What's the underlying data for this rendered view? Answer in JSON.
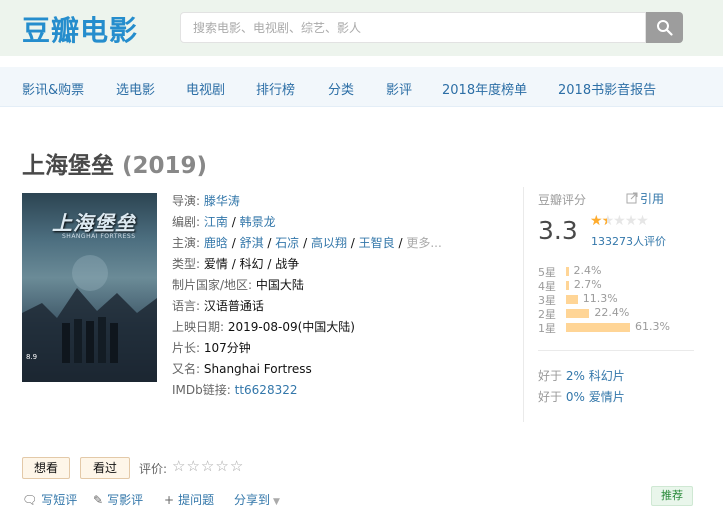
{
  "header": {
    "logo": "豆瓣电影",
    "search_placeholder": "搜索电影、电视剧、综艺、影人",
    "search_icon": "search-icon"
  },
  "nav": {
    "items": [
      "影讯&购票",
      "选电影",
      "电视剧",
      "排行榜",
      "分类",
      "影评",
      "2018年度榜单",
      "2018书影音报告"
    ]
  },
  "movie": {
    "title": "上海堡垒",
    "year": "(2019)",
    "poster": {
      "title": "上海堡垒",
      "subtitle": "SHANGHAI FORTRESS",
      "date": "8.9"
    },
    "director_label": "导演:",
    "director": "滕华涛",
    "writer_label": "编剧:",
    "writers": [
      "江南",
      "韩景龙"
    ],
    "cast_label": "主演:",
    "cast": [
      "鹿晗",
      "舒淇",
      "石凉",
      "高以翔",
      "王智良"
    ],
    "cast_more": "更多...",
    "genre_label": "类型:",
    "genres": "爱情 / 科幻 / 战争",
    "country_label": "制片国家/地区:",
    "country": "中国大陆",
    "language_label": "语言:",
    "language": "汉语普通话",
    "release_label": "上映日期:",
    "release": "2019-08-09(中国大陆)",
    "runtime_label": "片长:",
    "runtime": "107分钟",
    "aka_label": "又名:",
    "aka": "Shanghai Fortress",
    "imdb_label": "IMDb链接:",
    "imdb": "tt6628322"
  },
  "rating": {
    "title": "豆瓣评分",
    "cite": "引用",
    "score": "3.3",
    "stars_filled": 1.5,
    "votes": "133273人评价",
    "distribution": [
      {
        "label": "5星",
        "pct": "2.4%",
        "value": 2.4
      },
      {
        "label": "4星",
        "pct": "2.7%",
        "value": 2.7
      },
      {
        "label": "3星",
        "pct": "11.3%",
        "value": 11.3
      },
      {
        "label": "2星",
        "pct": "22.4%",
        "value": 22.4
      },
      {
        "label": "1星",
        "pct": "61.3%",
        "value": 61.3
      }
    ],
    "better_than": [
      {
        "prefix": "好于",
        "value": "2% 科幻片"
      },
      {
        "prefix": "好于",
        "value": "0% 爱情片"
      }
    ],
    "star_color": "#ffac2d",
    "bar_color": "#ffd596"
  },
  "actions": {
    "want": "想看",
    "seen": "看过",
    "my_rating_label": "评价:",
    "short_review": "写短评",
    "review": "写影评",
    "question": "提问题",
    "share": "分享到",
    "recommend": "推荐"
  }
}
